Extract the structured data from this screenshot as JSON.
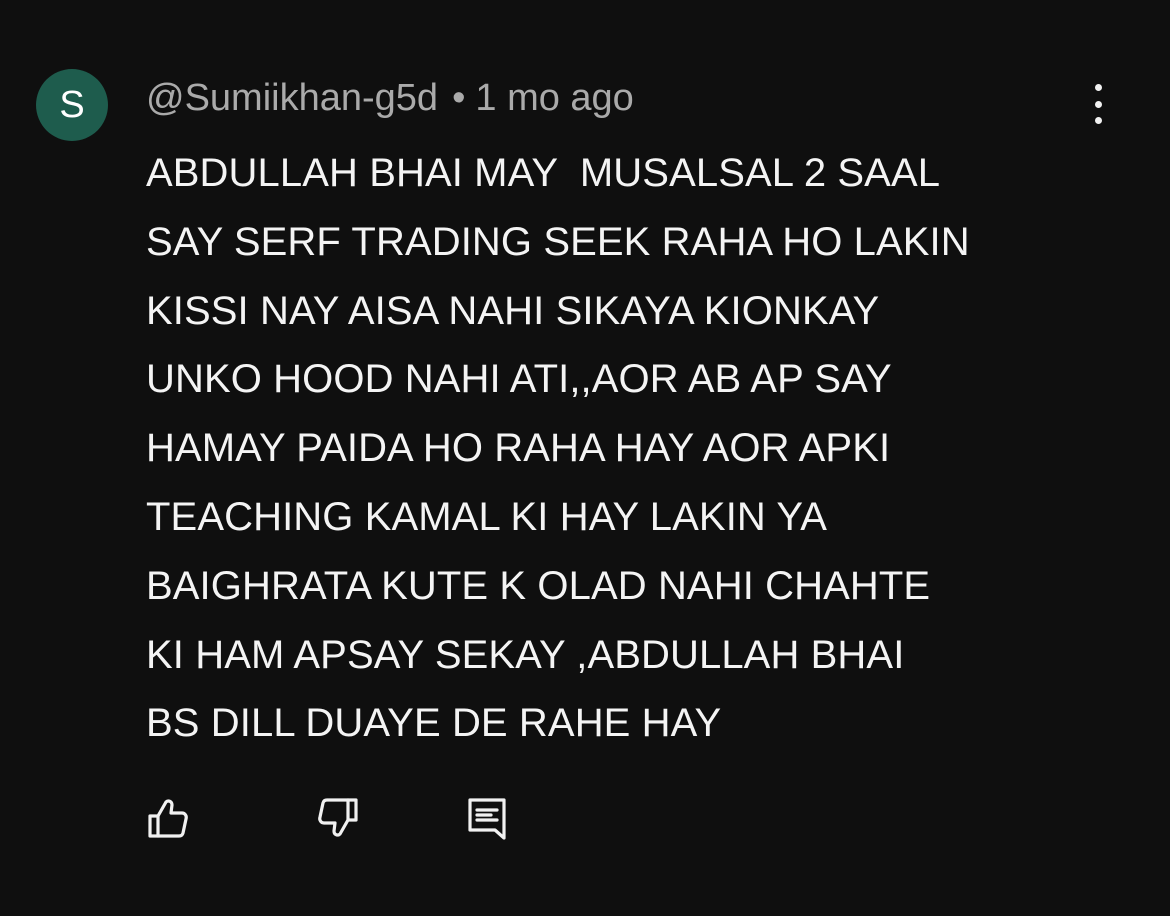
{
  "comment": {
    "avatar_letter": "S",
    "avatar_color": "#1e5c4d",
    "author": "@Sumiikhan-g5d",
    "separator": "•",
    "timestamp": "1 mo ago",
    "body_lines": [
      "ABDULLAH BHAI MAY  MUSALSAL 2 SAAL",
      "SAY SERF TRADING SEEK RAHA HO LAKIN",
      "KISSI NAY AISA NAHI SIKAYA KIONKAY",
      "UNKO HOOD NAHI ATI,,AOR AB AP SAY",
      "HAMAY PAIDA HO RAHA HAY AOR APKI",
      "TEACHING KAMAL KI HAY LAKIN YA",
      "BAIGHRATA KUTE K OLAD NAHI CHAHTE",
      "KI HAM APSAY SEKAY ,ABDULLAH BHAI",
      "BS DILL DUAYE DE RAHE HAY"
    ]
  },
  "actions": {
    "like_icon": "thumbs-up-icon",
    "dislike_icon": "thumbs-down-icon",
    "reply_icon": "reply-comment-icon",
    "menu_icon": "more-vertical-icon"
  },
  "colors": {
    "background": "#0f0f0f",
    "text_primary": "#f1f1f1",
    "text_secondary": "#aaaaaa"
  }
}
